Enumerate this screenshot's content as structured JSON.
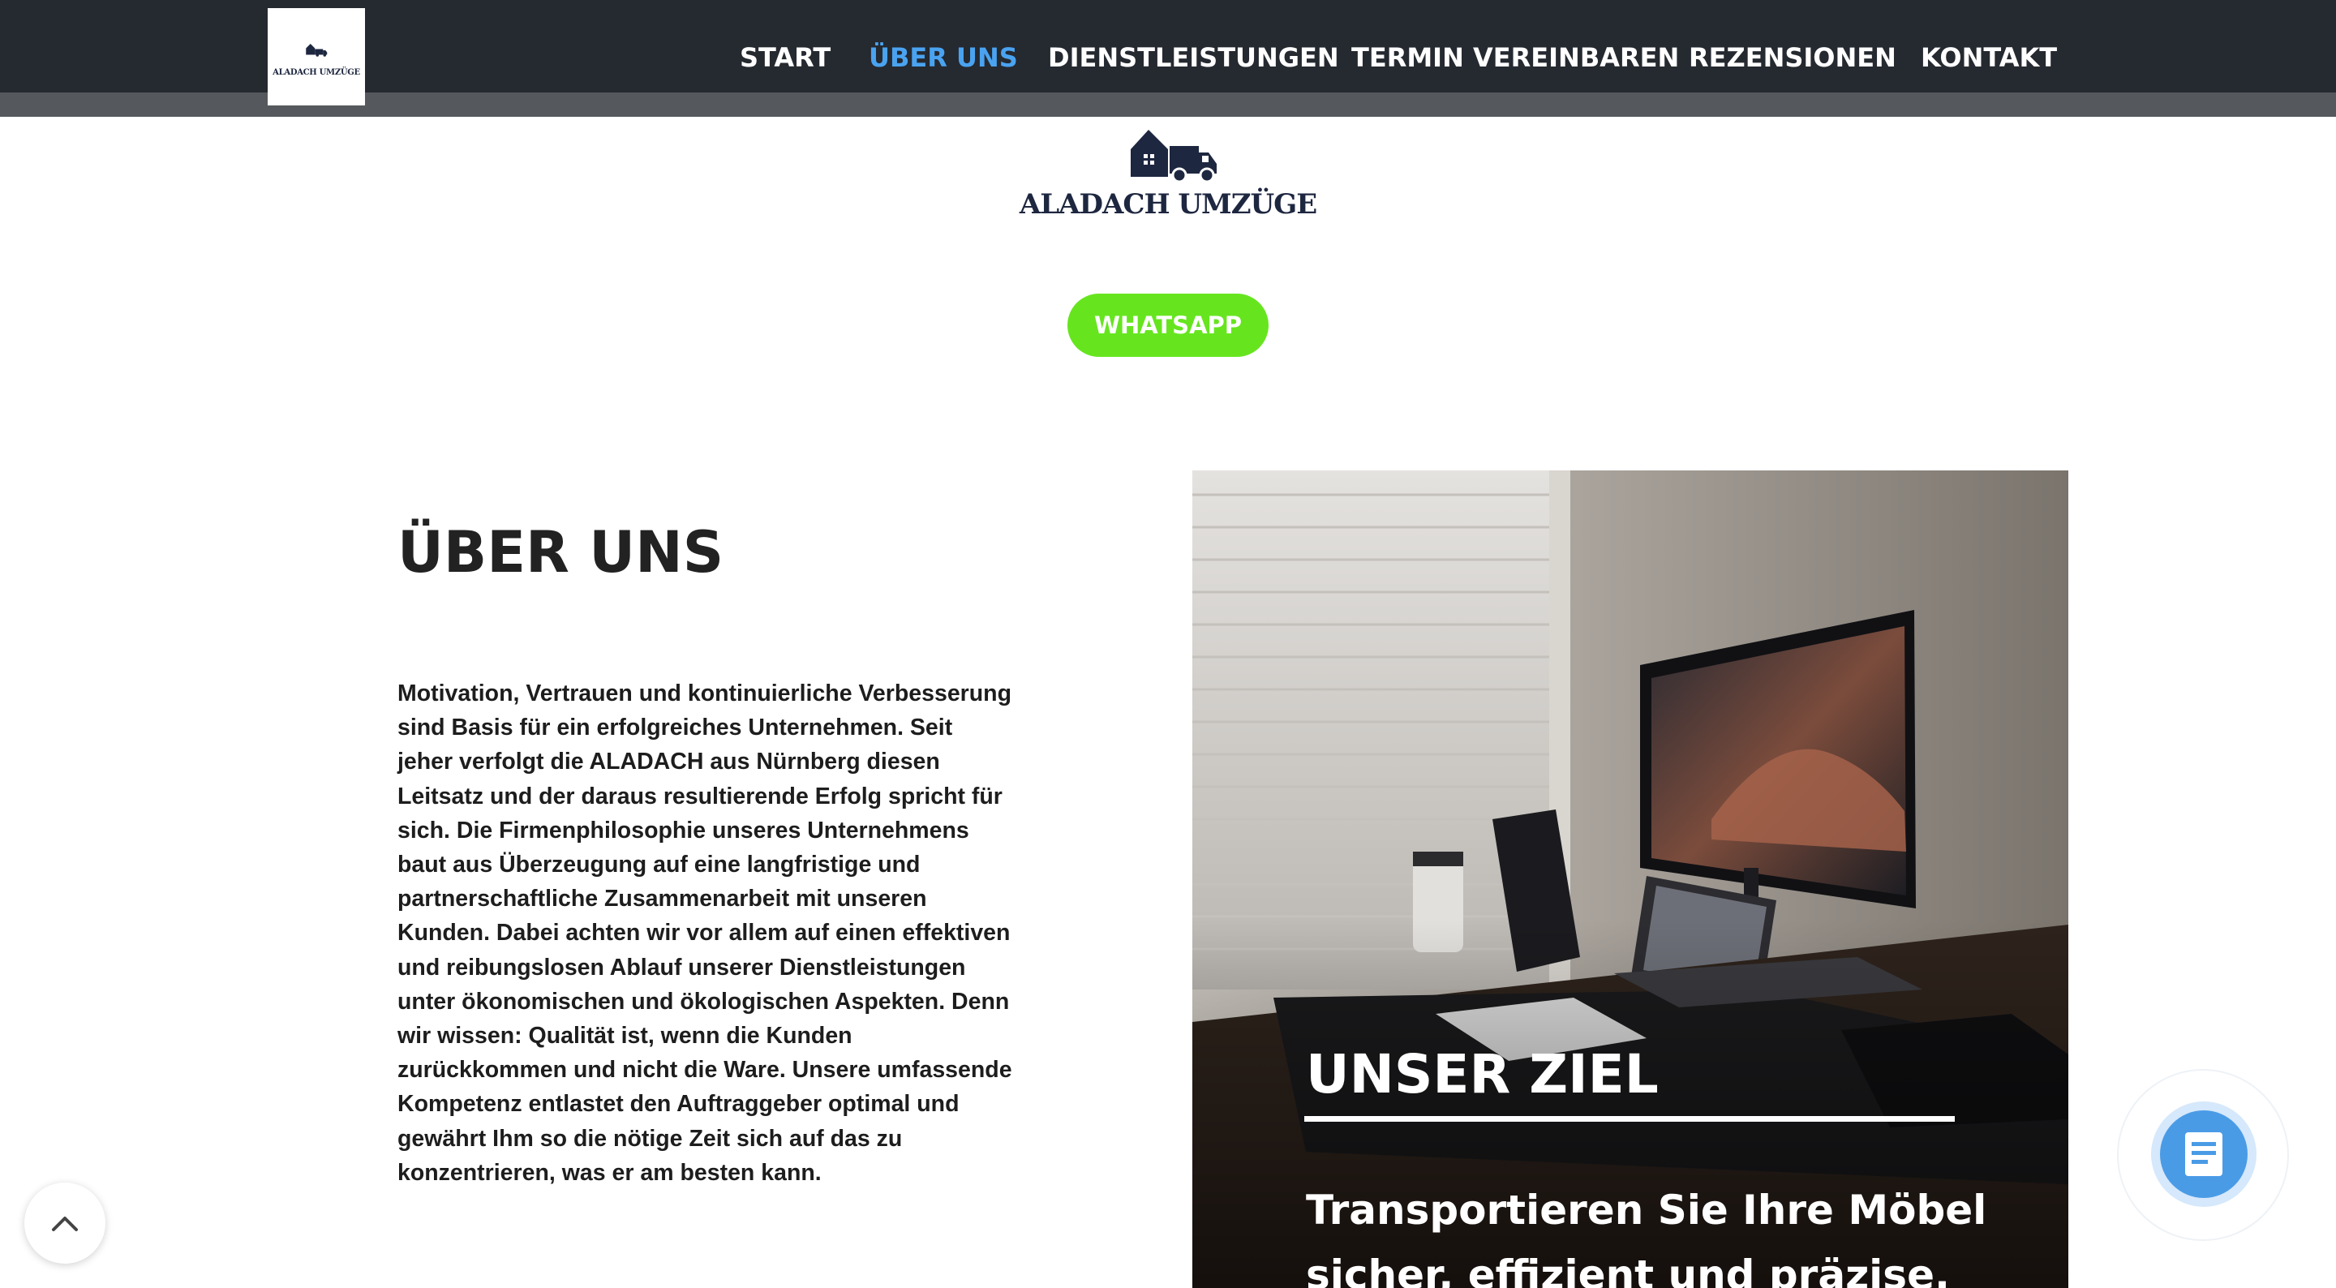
{
  "header": {
    "logo_text": "ALADACH UMZÜGE",
    "nav": [
      {
        "label": "START",
        "active": false
      },
      {
        "label": "ÜBER UNS",
        "active": true
      },
      {
        "label": "DIENSTLEISTUNGEN",
        "active": false
      },
      {
        "label": "TERMIN VEREINBAREN",
        "active": false
      },
      {
        "label": "REZENSIONEN",
        "active": false
      },
      {
        "label": "KONTAKT",
        "active": false
      }
    ]
  },
  "brand": {
    "name": "ALADACH UMZÜGE",
    "whatsapp_label": "WHATSAPP"
  },
  "about": {
    "title": "ÜBER UNS",
    "text": "Motivation, Vertrauen und kontinuierliche Verbesserung sind Basis für ein erfolgreiches Unternehmen. Seit jeher verfolgt die ALADACH aus Nürnberg diesen Leitsatz und der daraus resultierende Erfolg spricht für sich. Die Firmenphilosophie unseres Unternehmens baut aus Überzeugung auf eine langfristige und partnerschaftliche Zusammenarbeit mit unseren Kunden. Dabei achten wir vor allem auf einen effektiven und reibungslosen Ablauf unserer Dienstleistungen unter ökonomischen und ökologischen Aspekten. Denn wir wissen: Qualität ist, wenn die Kunden zurückkommen und nicht die Ware. Unsere umfassende Kompetenz entlastet den Auftraggeber optimal und gewährt Ihm so die nötige Zeit sich auf das zu konzentrieren, was er am besten kann."
  },
  "goal": {
    "title": "UNSER ZIEL",
    "text": "Transportieren Sie Ihre Möbel sicher, effizient und präzise."
  },
  "icons": {
    "scroll_top": "chevron-up-icon",
    "chat": "document-icon",
    "brand_mark": "house-truck-icon"
  },
  "colors": {
    "nav_bg": "#252930",
    "nav_active": "#4aa3f0",
    "whatsapp": "#66e51f",
    "brand_navy": "#1e2740",
    "chat_accent": "#4a9be6"
  }
}
